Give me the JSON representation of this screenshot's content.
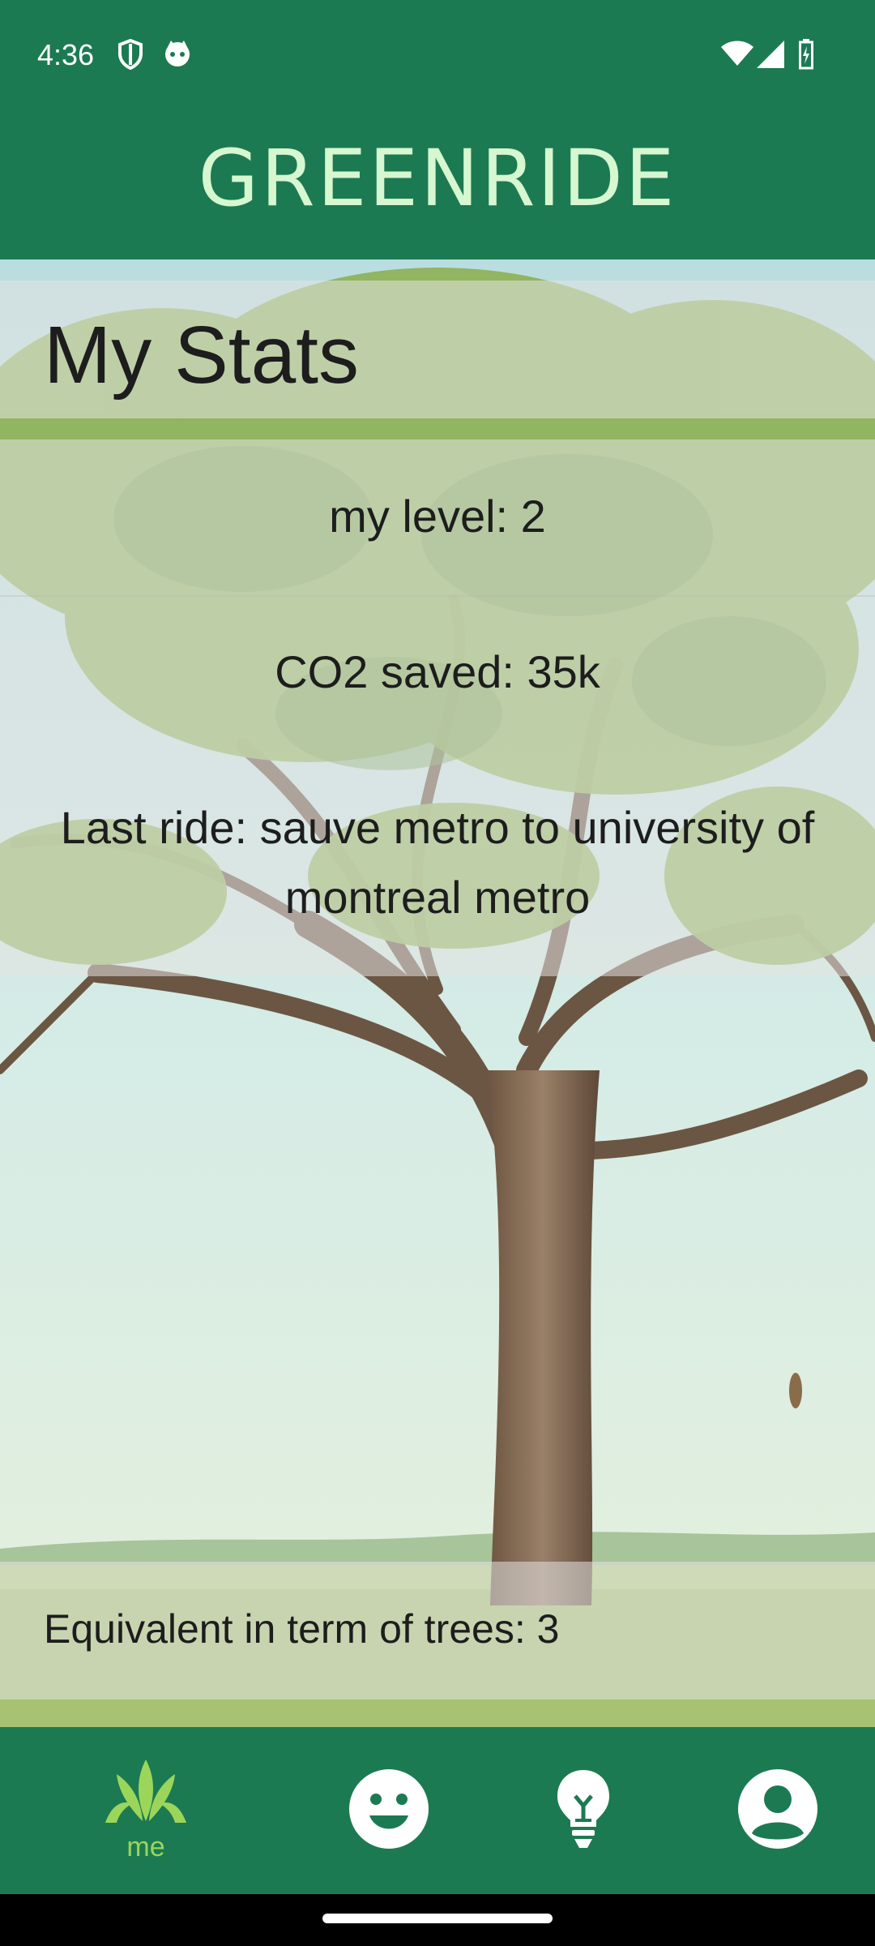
{
  "status_bar": {
    "time": "4:36",
    "icons": [
      "shield-icon",
      "face-badge-icon",
      "wifi-icon",
      "signal-icon",
      "battery-icon"
    ]
  },
  "app_bar": {
    "title": "GREENRIDE"
  },
  "stats_page": {
    "title": "My Stats",
    "level": "my level: 2",
    "co2_saved": "CO2 saved: 35k",
    "last_ride": "Last ride: sauve metro to university of montreal metro",
    "trees_equivalent": "Equivalent in term of trees: 3"
  },
  "bottom_nav": {
    "items": [
      {
        "label": "me",
        "icon": "sprout-icon",
        "selected": true
      },
      {
        "label": "",
        "icon": "smiley-icon",
        "selected": false
      },
      {
        "label": "",
        "icon": "lightbulb-icon",
        "selected": false
      },
      {
        "label": "",
        "icon": "account-icon",
        "selected": false
      }
    ]
  },
  "colors": {
    "primary": "#1c7a52",
    "title_text": "#d6f7d0",
    "nav_active": "#9bd65a",
    "nav_icon": "#ffffff"
  }
}
